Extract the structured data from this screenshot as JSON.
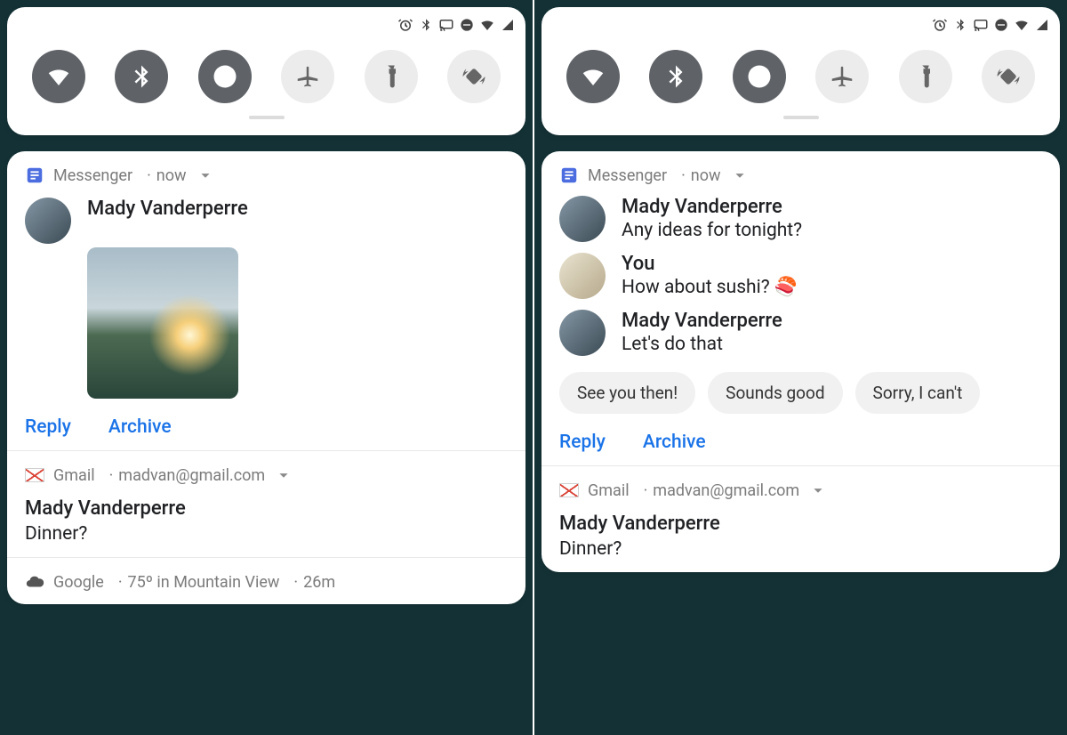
{
  "statusIcons": [
    "alarm",
    "bluetooth",
    "cast",
    "dnd",
    "wifi",
    "cell"
  ],
  "tiles": [
    {
      "name": "wifi",
      "on": true
    },
    {
      "name": "bluetooth",
      "on": true
    },
    {
      "name": "dnd",
      "on": true
    },
    {
      "name": "airplane",
      "on": false
    },
    {
      "name": "flashlight",
      "on": false
    },
    {
      "name": "autorotate",
      "on": false
    }
  ],
  "left": {
    "messenger": {
      "app": "Messenger",
      "time": "now",
      "sender": "Mady Vanderperre",
      "actions": {
        "reply": "Reply",
        "archive": "Archive"
      }
    },
    "gmail": {
      "app": "Gmail",
      "account": "madvan@gmail.com",
      "sender": "Mady Vanderperre",
      "snippet": "Dinner?"
    },
    "weather": {
      "app": "Google",
      "summary": "75º in Mountain View",
      "time": "26m"
    }
  },
  "right": {
    "messenger": {
      "app": "Messenger",
      "time": "now",
      "messages": [
        {
          "who": "Mady Vanderperre",
          "text": "Any ideas for tonight?",
          "self": false
        },
        {
          "who": "You",
          "text": "How about sushi? 🍣",
          "self": true
        },
        {
          "who": "Mady Vanderperre",
          "text": "Let's do that",
          "self": false
        }
      ],
      "chips": [
        "See you then!",
        "Sounds good",
        "Sorry, I can't"
      ],
      "actions": {
        "reply": "Reply",
        "archive": "Archive"
      }
    },
    "gmail": {
      "app": "Gmail",
      "account": "madvan@gmail.com",
      "sender": "Mady Vanderperre",
      "snippet": "Dinner?"
    }
  }
}
